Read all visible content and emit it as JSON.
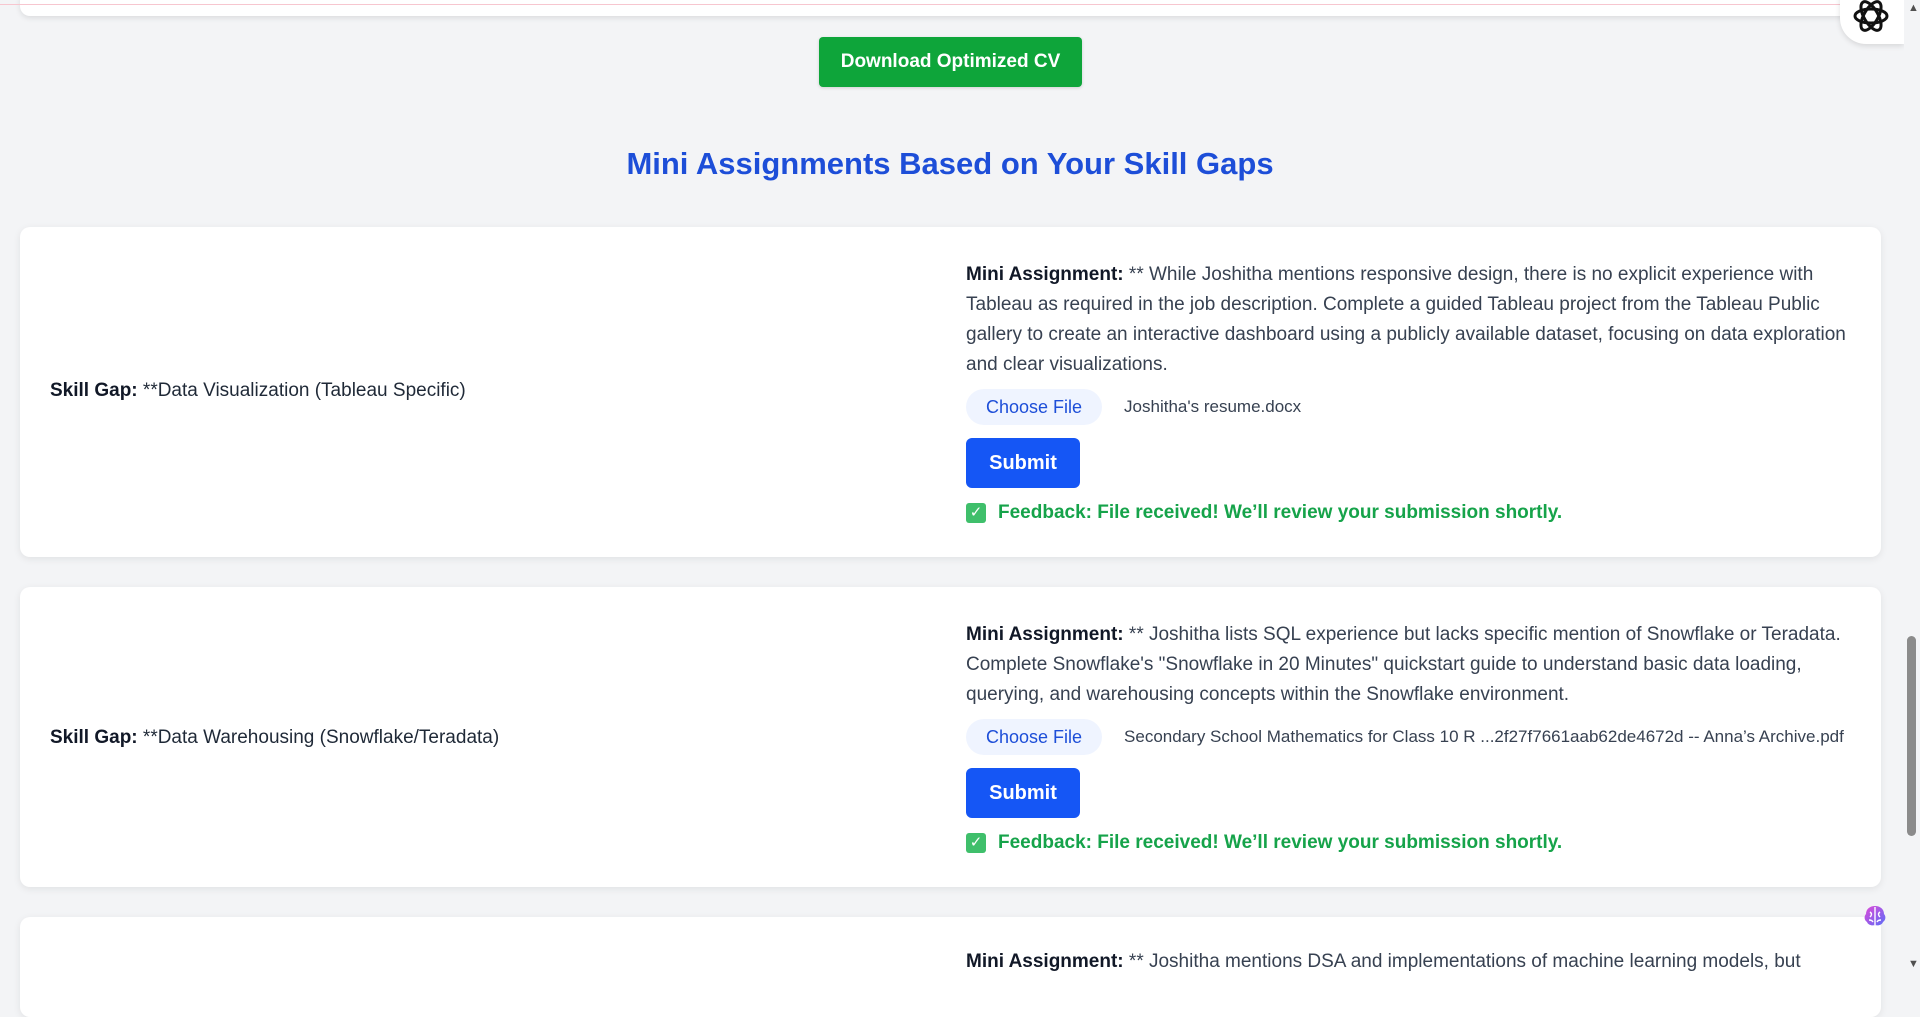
{
  "header": {
    "download_label": "Download Optimized CV"
  },
  "section": {
    "title": "Mini Assignments Based on Your Skill Gaps"
  },
  "labels": {
    "skill_gap": "Skill Gap:",
    "mini_assignment": "Mini Assignment:",
    "choose_file": "Choose File",
    "submit": "Submit"
  },
  "assignments": [
    {
      "skill_gap": "**Data Visualization (Tableau Specific)",
      "assignment": "** While Joshitha mentions responsive design, there is no explicit experience with Tableau as required in the job description. Complete a guided Tableau project from the Tableau Public gallery to create an interactive dashboard using a publicly available dataset, focusing on data exploration and clear visualizations.",
      "file_name": "Joshitha's resume.docx",
      "feedback": "Feedback: File received! We’ll review your submission shortly."
    },
    {
      "skill_gap": "**Data Warehousing (Snowflake/Teradata)",
      "assignment": "** Joshitha lists SQL experience but lacks specific mention of Snowflake or Teradata. Complete Snowflake's \"Snowflake in 20 Minutes\" quickstart guide to understand basic data loading, querying, and warehousing concepts within the Snowflake environment.",
      "file_name": "Secondary School Mathematics for Class 10 R ...2f27f7661aab62de4672d -- Anna’s Archive.pdf",
      "feedback": "Feedback: File received! We’ll review your submission shortly."
    },
    {
      "assignment": "** Joshitha mentions DSA and implementations of machine learning models, but"
    }
  ],
  "colors": {
    "accent_blue": "#1d4ed8",
    "submit_blue": "#1556f5",
    "download_green": "#0ea53a",
    "feedback_green": "#16a34a"
  },
  "icons": [
    "check-icon",
    "openai-icon",
    "brain-icon"
  ]
}
